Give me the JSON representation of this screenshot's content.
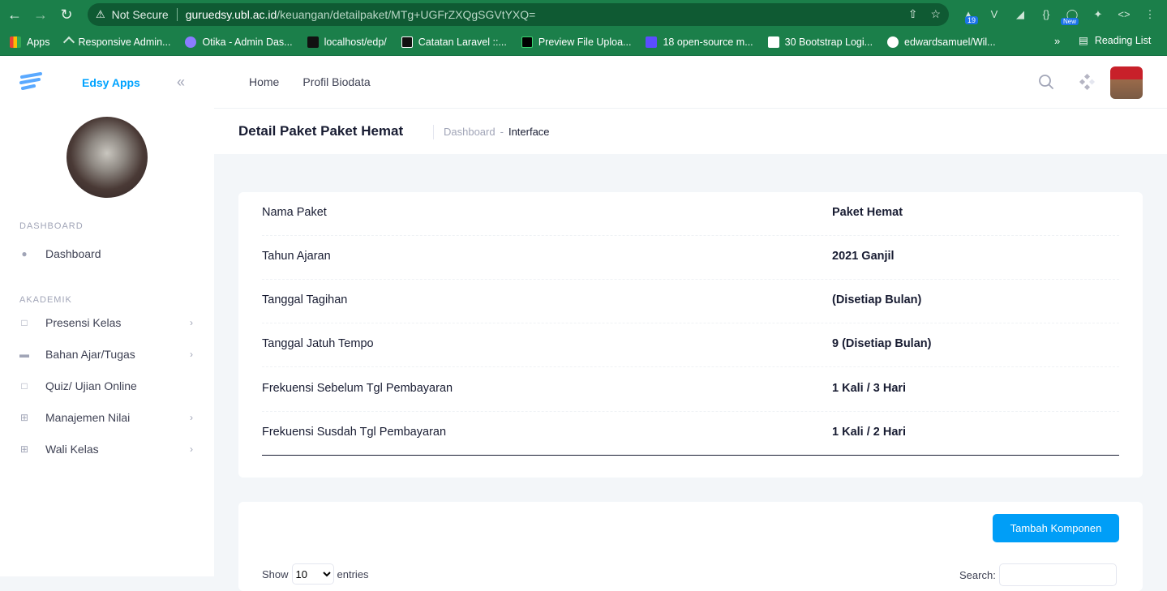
{
  "browser": {
    "security": "Not Secure",
    "url_host": "guruedsy.ubl.ac.id",
    "url_path": "/keuangan/detailpaket/MTg+UGFrZXQgSGVtYXQ=",
    "ext_badge": "19",
    "ext_new": "New",
    "bookmarks": [
      "Apps",
      "Responsive Admin...",
      "Otika - Admin Das...",
      "localhost/edp/",
      "Catatan Laravel ::...",
      "Preview File Uploa...",
      "18 open-source m...",
      "30 Bootstrap Logi...",
      "edwardsamuel/Wil..."
    ],
    "more": "»",
    "reading_list": "Reading List"
  },
  "sidebar": {
    "brand": "Edsy Apps",
    "sections": [
      {
        "label": "DASHBOARD",
        "items": [
          {
            "label": "Dashboard",
            "icon": "flame-icon",
            "arrow": false
          }
        ]
      },
      {
        "label": "AKADEMIK",
        "items": [
          {
            "label": "Presensi Kelas",
            "icon": "bookmark-icon",
            "arrow": true
          },
          {
            "label": "Bahan Ajar/Tugas",
            "icon": "inbox-icon",
            "arrow": true
          },
          {
            "label": "Quiz/ Ujian Online",
            "icon": "calendar-icon",
            "arrow": false
          },
          {
            "label": "Manajemen Nilai",
            "icon": "plus-square-icon",
            "arrow": true
          },
          {
            "label": "Wali Kelas",
            "icon": "plus-square-outline-icon",
            "arrow": true
          }
        ]
      }
    ]
  },
  "header": {
    "nav": [
      "Home",
      "Profil Biodata"
    ]
  },
  "toolbar": {
    "title": "Detail Paket Paket Hemat",
    "breadcrumb": [
      "Dashboard",
      "-",
      "Interface"
    ]
  },
  "details": [
    {
      "label": "Nama Paket",
      "value": "Paket Hemat"
    },
    {
      "label": "Tahun Ajaran",
      "value": "2021 Ganjil"
    },
    {
      "label": "Tanggal Tagihan",
      "value": "(Disetiap Bulan)"
    },
    {
      "label": "Tanggal Jatuh Tempo",
      "value": "9 (Disetiap Bulan)"
    },
    {
      "label": "Frekuensi Sebelum Tgl Pembayaran",
      "value": "1 Kali / 3 Hari"
    },
    {
      "label": "Frekuensi Susdah Tgl Pembayaran",
      "value": "1 Kali / 2 Hari"
    }
  ],
  "table_card": {
    "add_button": "Tambah Komponen",
    "show_label": "Show",
    "entries_value": "10",
    "entries_label": "entries",
    "search_label": "Search:"
  },
  "colors": {
    "primary": "#009ef7",
    "brand": "#00a3ff",
    "chrome": "#1b7f4a"
  }
}
